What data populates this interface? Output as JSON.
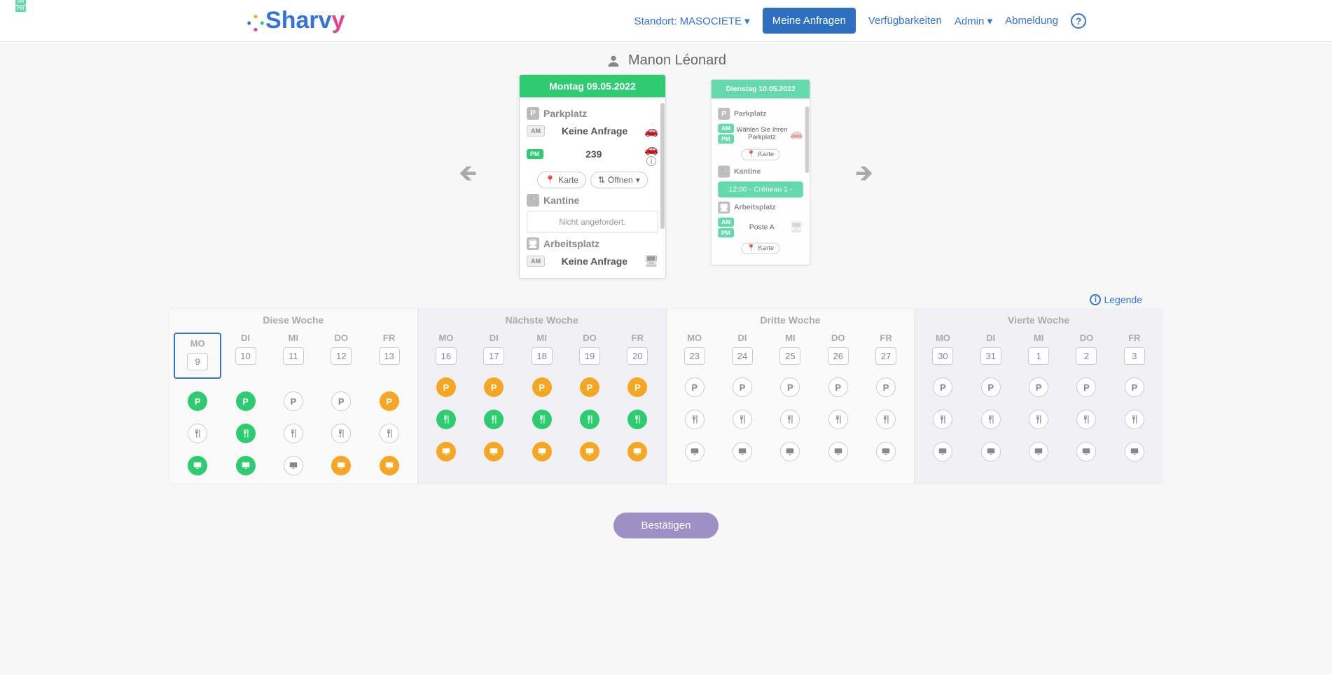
{
  "header": {
    "brand": "Sharvy",
    "location_label": "Standort: MASOCIETE",
    "nav_requests": "Meine Anfragen",
    "nav_avail": "Verfügbarkeiten",
    "nav_admin": "Admin",
    "nav_logout": "Abmeldung"
  },
  "user": {
    "name": "Manon Léonard"
  },
  "focus_card": {
    "title": "Montag 09.05.2022",
    "parking_label": "Parkplatz",
    "am": "AM",
    "pm": "PM",
    "no_request": "Keine Anfrage",
    "slot_value": "239",
    "map_btn": "Karte",
    "open_btn": "Öffnen",
    "cantine_label": "Kantine",
    "not_requested": "Nicht angefordert.",
    "work_label": "Arbeitsplatz"
  },
  "next_card": {
    "title": "Dienstag 10.05.2022",
    "parking_label": "Parkplatz",
    "am": "AM",
    "pm": "PM",
    "choose": "Wählen Sie Ihren Parkplatz",
    "map_btn": "Karte",
    "cantine_label": "Kantine",
    "slot": "12:00 - Créneau 1 -",
    "work_label": "Arbeitsplatz",
    "poste": "Poste A"
  },
  "legend": "Legende",
  "weeks": [
    {
      "title": "Diese Woche",
      "alt": false,
      "days": [
        {
          "abbr": "MO",
          "num": "9",
          "sel": true,
          "p": "green",
          "pt": true,
          "k": "white",
          "w": "green",
          "wt": true
        },
        {
          "abbr": "DI",
          "num": "10",
          "p": "green",
          "k": "green",
          "w": "green"
        },
        {
          "abbr": "MI",
          "num": "11",
          "p": "white",
          "k": "white",
          "w": "white"
        },
        {
          "abbr": "DO",
          "num": "12",
          "p": "white",
          "k": "white",
          "w": "orange"
        },
        {
          "abbr": "FR",
          "num": "13",
          "p": "orange",
          "k": "white",
          "w": "orange"
        }
      ]
    },
    {
      "title": "Nächste Woche",
      "alt": true,
      "days": [
        {
          "abbr": "MO",
          "num": "16",
          "p": "orange",
          "k": "green",
          "w": "orange"
        },
        {
          "abbr": "DI",
          "num": "17",
          "p": "orange",
          "k": "green",
          "w": "orange"
        },
        {
          "abbr": "MI",
          "num": "18",
          "p": "orange",
          "k": "green",
          "w": "orange"
        },
        {
          "abbr": "DO",
          "num": "19",
          "p": "orange",
          "k": "green",
          "w": "orange"
        },
        {
          "abbr": "FR",
          "num": "20",
          "p": "orange",
          "k": "green",
          "w": "orange"
        }
      ]
    },
    {
      "title": "Dritte Woche",
      "alt": false,
      "days": [
        {
          "abbr": "MO",
          "num": "23",
          "p": "white",
          "k": "white",
          "w": "white"
        },
        {
          "abbr": "DI",
          "num": "24",
          "p": "white",
          "k": "white",
          "w": "white"
        },
        {
          "abbr": "MI",
          "num": "25",
          "p": "white",
          "k": "white",
          "w": "white"
        },
        {
          "abbr": "DO",
          "num": "26",
          "p": "white",
          "k": "white",
          "w": "white"
        },
        {
          "abbr": "FR",
          "num": "27",
          "p": "white",
          "k": "white",
          "w": "white"
        }
      ]
    },
    {
      "title": "Vierte Woche",
      "alt": true,
      "days": [
        {
          "abbr": "MO",
          "num": "30",
          "p": "white",
          "k": "white",
          "w": "white"
        },
        {
          "abbr": "DI",
          "num": "31",
          "p": "white",
          "k": "white",
          "w": "white"
        },
        {
          "abbr": "MI",
          "num": "1",
          "p": "white",
          "k": "white",
          "w": "white"
        },
        {
          "abbr": "DO",
          "num": "2",
          "p": "white",
          "k": "white",
          "w": "white"
        },
        {
          "abbr": "FR",
          "num": "3",
          "p": "white",
          "k": "white",
          "w": "white"
        }
      ]
    }
  ],
  "confirm": "Bestätigen"
}
